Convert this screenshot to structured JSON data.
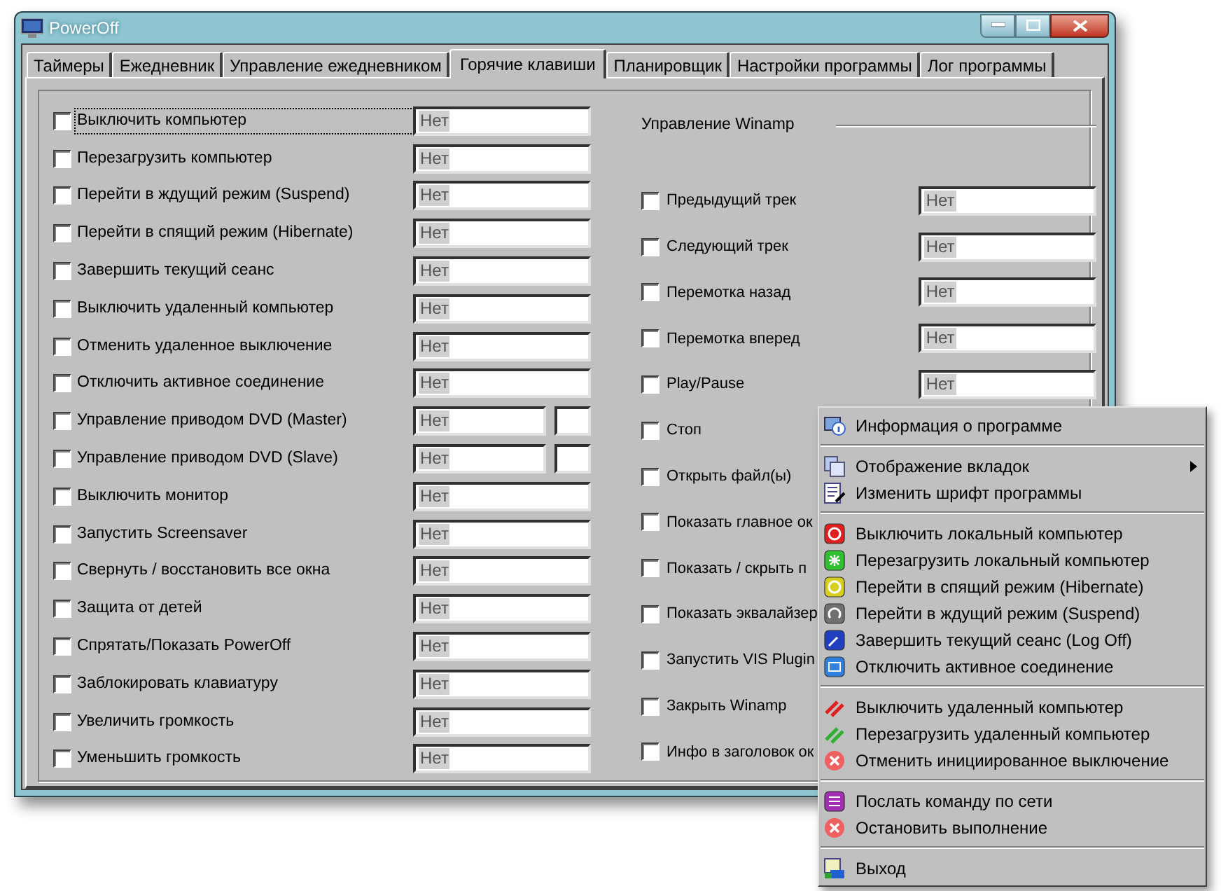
{
  "window": {
    "title": "PowerOff"
  },
  "tabs": [
    {
      "label": "Таймеры",
      "selected": false
    },
    {
      "label": "Ежедневник",
      "selected": false
    },
    {
      "label": "Управление ежедневником",
      "selected": false
    },
    {
      "label": "Горячие клавиши",
      "selected": true
    },
    {
      "label": "Планировщик",
      "selected": false
    },
    {
      "label": "Настройки программы",
      "selected": false
    },
    {
      "label": "Лог программы",
      "selected": false
    }
  ],
  "hotkeys": [
    {
      "label": "Выключить компьютер",
      "checked": false,
      "focused": true,
      "value": "Нет",
      "extra_field": false
    },
    {
      "label": "Перезагрузить компьютер",
      "checked": false,
      "focused": false,
      "value": "Нет",
      "extra_field": false
    },
    {
      "label": "Перейти в ждущий режим (Suspend)",
      "checked": false,
      "focused": false,
      "value": "Нет",
      "extra_field": false
    },
    {
      "label": "Перейти в спящий режим (Hibernate)",
      "checked": false,
      "focused": false,
      "value": "Нет",
      "extra_field": false
    },
    {
      "label": "Завершить текущий сеанс",
      "checked": false,
      "focused": false,
      "value": "Нет",
      "extra_field": false
    },
    {
      "label": "Выключить удаленный компьютер",
      "checked": false,
      "focused": false,
      "value": "Нет",
      "extra_field": false
    },
    {
      "label": "Отменить удаленное выключение",
      "checked": false,
      "focused": false,
      "value": "Нет",
      "extra_field": false
    },
    {
      "label": "Отключить активное соединение",
      "checked": false,
      "focused": false,
      "value": "Нет",
      "extra_field": false
    },
    {
      "label": "Управление приводом DVD (Master)",
      "checked": false,
      "focused": false,
      "value": "Нет",
      "extra_field": true
    },
    {
      "label": "Управление приводом DVD (Slave)",
      "checked": false,
      "focused": false,
      "value": "Нет",
      "extra_field": true
    },
    {
      "label": "Выключить монитор",
      "checked": false,
      "focused": false,
      "value": "Нет",
      "extra_field": false
    },
    {
      "label": "Запустить Screensaver",
      "checked": false,
      "focused": false,
      "value": "Нет",
      "extra_field": false
    },
    {
      "label": "Свернуть / восстановить все окна",
      "checked": false,
      "focused": false,
      "value": "Нет",
      "extra_field": false
    },
    {
      "label": "Защита от детей",
      "checked": false,
      "focused": false,
      "value": "Нет",
      "extra_field": false
    },
    {
      "label": "Спрятать/Показать PowerOff",
      "checked": false,
      "focused": false,
      "value": "Нет",
      "extra_field": false
    },
    {
      "label": "Заблокировать клавиатуру",
      "checked": false,
      "focused": false,
      "value": "Нет",
      "extra_field": false
    },
    {
      "label": "Увеличить громкость",
      "checked": false,
      "focused": false,
      "value": "Нет",
      "extra_field": false
    },
    {
      "label": "Уменьшить громкость",
      "checked": false,
      "focused": false,
      "value": "Нет",
      "extra_field": false
    }
  ],
  "winamp": {
    "title": "Управление Winamp",
    "rows": [
      {
        "label": "Предыдущий трек",
        "checked": false,
        "field": true,
        "value": "Нет"
      },
      {
        "label": "Следующий трек",
        "checked": false,
        "field": true,
        "value": "Нет"
      },
      {
        "label": "Перемотка назад",
        "checked": false,
        "field": true,
        "value": "Нет"
      },
      {
        "label": "Перемотка вперед",
        "checked": false,
        "field": true,
        "value": "Нет"
      },
      {
        "label": "Play/Pause",
        "checked": false,
        "field": true,
        "value": "Нет"
      },
      {
        "label": "Стоп",
        "checked": false
      },
      {
        "label": "Открыть файл(ы)",
        "checked": false
      },
      {
        "label": "Показать главное ок",
        "checked": false
      },
      {
        "label": "Показать / скрыть п",
        "checked": false
      },
      {
        "label": "Показать эквалайзер",
        "checked": false
      },
      {
        "label": "Запустить VIS Plugin",
        "checked": false
      },
      {
        "label": "Закрыть Winamp",
        "checked": false
      },
      {
        "label": "Инфо в заголовок ок",
        "checked": false
      }
    ]
  },
  "context_menu": [
    {
      "kind": "item",
      "label": "Информация о программе",
      "submenu": false
    },
    {
      "kind": "separator"
    },
    {
      "kind": "item",
      "label": "Отображение вкладок",
      "submenu": true
    },
    {
      "kind": "item",
      "label": "Изменить шрифт программы",
      "submenu": false
    },
    {
      "kind": "separator"
    },
    {
      "kind": "item",
      "label": "Выключить локальный компьютер",
      "submenu": false
    },
    {
      "kind": "item",
      "label": "Перезагрузить локальный компьютер",
      "submenu": false
    },
    {
      "kind": "item",
      "label": "Перейти в спящий режим (Hibernate)",
      "submenu": false
    },
    {
      "kind": "item",
      "label": "Перейти в ждущий режим (Suspend)",
      "submenu": false
    },
    {
      "kind": "item",
      "label": "Завершить текущий сеанс (Log Off)",
      "submenu": false
    },
    {
      "kind": "item",
      "label": "Отключить активное соединение",
      "submenu": false
    },
    {
      "kind": "separator"
    },
    {
      "kind": "item",
      "label": "Выключить удаленный компьютер",
      "submenu": false
    },
    {
      "kind": "item",
      "label": "Перезагрузить удаленный компьютер",
      "submenu": false
    },
    {
      "kind": "item",
      "label": "Отменить инициированное выключение",
      "submenu": false
    },
    {
      "kind": "separator"
    },
    {
      "kind": "item",
      "label": "Послать команду по сети",
      "submenu": false
    },
    {
      "kind": "item",
      "label": "Остановить выполнение",
      "submenu": false
    },
    {
      "kind": "separator"
    },
    {
      "kind": "item",
      "label": "Выход",
      "submenu": false
    }
  ]
}
